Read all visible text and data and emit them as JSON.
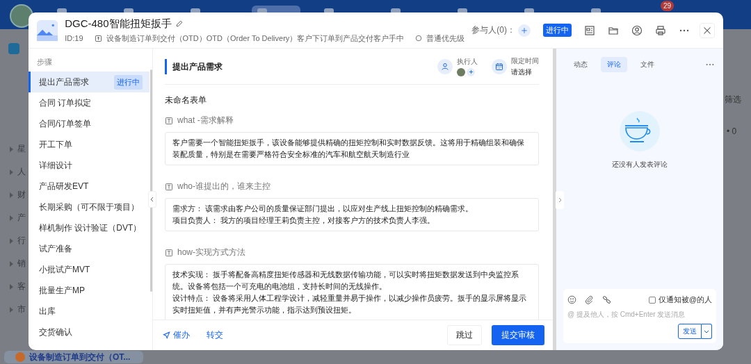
{
  "background": {
    "nav": [
      {
        "selected": false
      },
      {
        "selected": false
      },
      {
        "selected": false
      },
      {
        "selected": true
      },
      {
        "selected": false
      },
      {
        "selected": false
      },
      {
        "selected": false
      },
      {
        "selected": false
      },
      {
        "selected": false
      }
    ],
    "notification_count": "29",
    "sidebar": [
      "星",
      "人",
      "财",
      "产",
      "行",
      "销",
      "客",
      "市"
    ],
    "right_texts": [
      "筛选",
      "• 0"
    ],
    "current_process": "设备制造订单到交付（OT..."
  },
  "task": {
    "title": "DGC-480智能扭矩扳手",
    "id": "ID:19",
    "process": "设备制造订单到交付（OTD）OTD（Order To Delivery）客户下订单到产品交付客户手中",
    "priority": "普通优先级",
    "participants": "参与人(0)：",
    "status": "进行中"
  },
  "steps": {
    "heading": "步骤",
    "items": [
      {
        "label": "提出产品需求",
        "selected": true,
        "badge": "进行中"
      },
      {
        "label": "合同 订单拟定",
        "selected": false
      },
      {
        "label": "合同/订单签单",
        "selected": false
      },
      {
        "label": "开工下单",
        "selected": false
      },
      {
        "label": "详细设计",
        "selected": false
      },
      {
        "label": "产品研发EVT",
        "selected": false
      },
      {
        "label": "长期采购（可不限于项目）",
        "selected": false
      },
      {
        "label": "样机制作 设计验证（DVT）",
        "selected": false
      },
      {
        "label": "试产准备",
        "selected": false
      },
      {
        "label": "小批试产MVT",
        "selected": false
      },
      {
        "label": "批量生产MP",
        "selected": false
      },
      {
        "label": "出库",
        "selected": false
      },
      {
        "label": "交货确认",
        "selected": false
      }
    ]
  },
  "step_detail": {
    "title": "提出产品需求",
    "executor_label": "执行人",
    "deadline_label": "限定时间",
    "deadline_value": "请选择",
    "form_title": "未命名表单",
    "fields": [
      {
        "label": "what -需求解释",
        "lines": [
          "客户需要一个智能扭矩扳手，该设备能够提供精确的扭矩控制和实时数据反馈。这将用于精确组装和确保装配质量，特别是在需要严格符合安全标准的汽车和航空航天制造行业"
        ]
      },
      {
        "label": "who-谁提出的，谁来主控",
        "lines": [
          "需求方： 该需求由客户公司的质量保证部门提出，以应对生产线上扭矩控制的精确需求。",
          "项目负责人： 我方的项目经理王莉负责主控，对接客户方的技术负责人李强。"
        ]
      },
      {
        "label": "how-实现方式方法",
        "lines": [
          "技术实现： 扳手将配备高精度扭矩传感器和无线数据传输功能，可以实时将扭矩数据发送到中央监控系统。设备将包括一个可充电的电池组，支持长时间的无线操作。",
          "设计特点： 设备将采用人体工程学设计，减轻重量并易于操作，以减少操作员疲劳。扳手的显示屏将显示实时扭矩值，并有声光警示功能，指示达到预设扭矩。"
        ]
      }
    ],
    "footer_links": [
      "催办",
      "转交"
    ],
    "skip_button": "跳过",
    "submit_button": "提交审核"
  },
  "comments": {
    "tabs": [
      {
        "label": "动态",
        "selected": false
      },
      {
        "label": "评论",
        "selected": true
      },
      {
        "label": "文件",
        "selected": false
      }
    ],
    "empty_text": "还没有人发表评论",
    "notify_only_mentioned": {
      "label": "仅通知被@的人",
      "checked": false
    },
    "placeholder": "@ 提及他人，按 Cmd+Enter 发送消息",
    "send_button": "发送"
  }
}
